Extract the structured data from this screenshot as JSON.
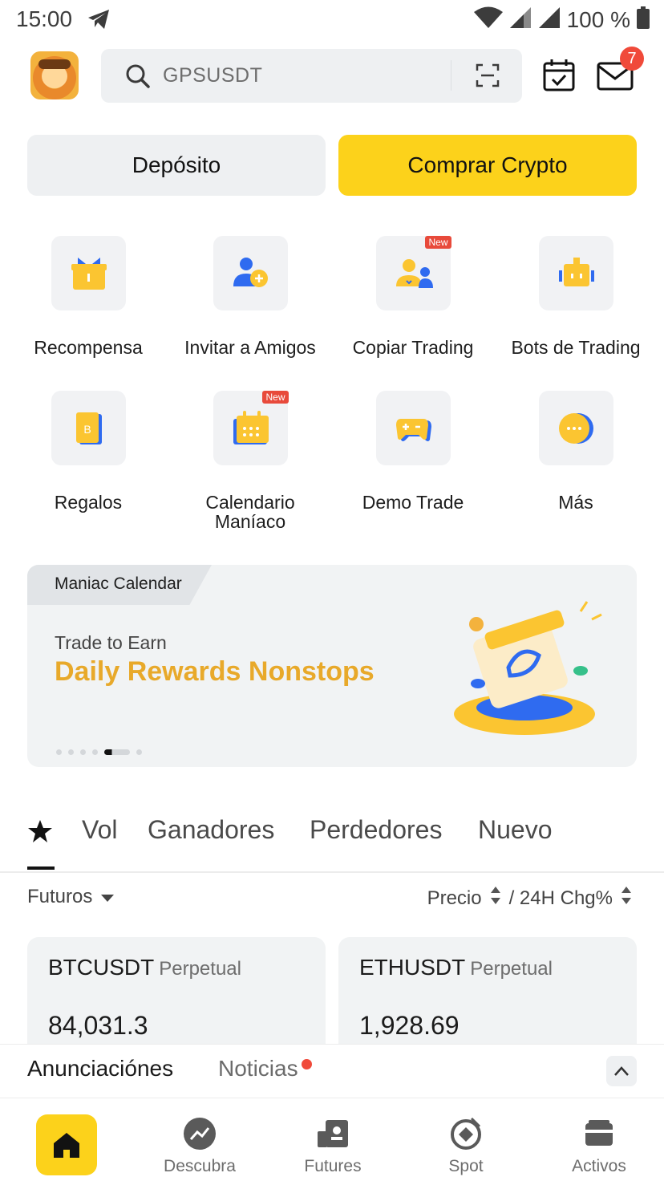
{
  "status_bar": {
    "time": "15:00",
    "battery": "100 %"
  },
  "header": {
    "search_text": "GPSUSDT",
    "mail_badge": "7"
  },
  "actions": {
    "deposit": "Depósito",
    "buy": "Comprar Crypto"
  },
  "shortcuts": [
    {
      "label": "Recompensa",
      "icon": "gift-icon",
      "tag": ""
    },
    {
      "label": "Invitar a Amigos",
      "icon": "add-friend-icon",
      "tag": ""
    },
    {
      "label": "Copiar Trading",
      "icon": "copy-trading-icon",
      "tag": "New"
    },
    {
      "label": "Bots de Trading",
      "icon": "bot-icon",
      "tag": ""
    },
    {
      "label": "Regalos",
      "icon": "gift-card-icon",
      "tag": ""
    },
    {
      "label": "Calendario Maníaco",
      "icon": "calendar-icon",
      "tag": "New"
    },
    {
      "label": "Demo Trade",
      "icon": "gamepad-icon",
      "tag": ""
    },
    {
      "label": "Más",
      "icon": "more-icon",
      "tag": ""
    }
  ],
  "banner": {
    "category": "Maniac Calendar",
    "subtitle": "Trade to Earn",
    "title": "Daily Rewards Nonstops",
    "active_index": 4,
    "accent": "#e8a92a"
  },
  "market": {
    "tabs": [
      "Vol",
      "Ganadores",
      "Perdedores",
      "Nuevo"
    ],
    "filter": "Futuros",
    "sort_price": "Precio",
    "sort_change": "/ 24H Chg%",
    "cards": [
      {
        "symbol": "BTCUSDT",
        "type": "Perpetual",
        "price": "84,031.3"
      },
      {
        "symbol": "ETHUSDT",
        "type": "Perpetual",
        "price": "1,928.69"
      }
    ]
  },
  "announcements": {
    "tab1": "Anunciaciónes",
    "tab2": "Noticias"
  },
  "bottom_nav": [
    {
      "label": "",
      "icon": "home-icon"
    },
    {
      "label": "Descubra",
      "icon": "discover-icon"
    },
    {
      "label": "Futures",
      "icon": "futures-icon"
    },
    {
      "label": "Spot",
      "icon": "spot-icon"
    },
    {
      "label": "Activos",
      "icon": "wallet-icon"
    }
  ],
  "colors": {
    "brand_yellow": "#fcd21b",
    "badge_red": "#f04a3a",
    "icon_blue": "#2f6bf0",
    "icon_yellow": "#fbc531"
  }
}
